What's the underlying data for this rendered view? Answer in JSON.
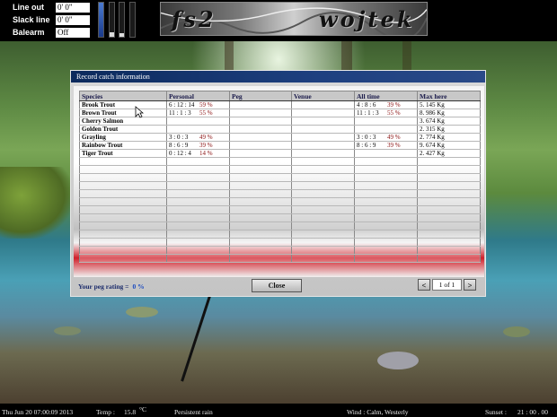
{
  "hud": {
    "line_out_label": "Line out",
    "line_out_value": "0' 0\"",
    "slack_line_label": "Slack line",
    "slack_line_value": "0' 0\"",
    "balearm_label": "Balearm",
    "balearm_value": "Off"
  },
  "logo": {
    "left_text": "fs2",
    "right_text": "wojtek"
  },
  "dialog": {
    "title": "Record catch information",
    "columns": [
      "Species",
      "Personal",
      "Peg",
      "Venue",
      "All time",
      "Max here"
    ],
    "rows": [
      {
        "species": "Brook Trout",
        "personal_time": "6 : 12 : 14",
        "personal_pct": "59 %",
        "peg": "",
        "venue": "",
        "alltime_time": "4 : 8 : 6",
        "alltime_pct": "39 %",
        "max": "5. 145 Kg"
      },
      {
        "species": "Brown Trout",
        "personal_time": "11 : 1 : 3",
        "personal_pct": "55 %",
        "peg": "",
        "venue": "",
        "alltime_time": "11 : 1 : 3",
        "alltime_pct": "55 %",
        "max": "8. 986 Kg"
      },
      {
        "species": "Cherry Salmon",
        "personal_time": "",
        "personal_pct": "",
        "peg": "",
        "venue": "",
        "alltime_time": "",
        "alltime_pct": "",
        "max": "3. 674 Kg"
      },
      {
        "species": "Golden Trout",
        "personal_time": "",
        "personal_pct": "",
        "peg": "",
        "venue": "",
        "alltime_time": "",
        "alltime_pct": "",
        "max": "2. 315 Kg"
      },
      {
        "species": "Grayling",
        "personal_time": "3 : 0 : 3",
        "personal_pct": "49 %",
        "peg": "",
        "venue": "",
        "alltime_time": "3 : 0 : 3",
        "alltime_pct": "49 %",
        "max": "2. 774 Kg"
      },
      {
        "species": "Rainbow Trout",
        "personal_time": "8 : 6 : 9",
        "personal_pct": "39 %",
        "peg": "",
        "venue": "",
        "alltime_time": "8 : 6 : 9",
        "alltime_pct": "39 %",
        "max": "9. 674 Kg"
      },
      {
        "species": "Tiger Trout",
        "personal_time": "0 : 12 : 4",
        "personal_pct": "14 %",
        "peg": "",
        "venue": "",
        "alltime_time": "",
        "alltime_pct": "",
        "max": "2. 427 Kg"
      }
    ],
    "rating_label": "Your peg rating =",
    "rating_value": "0 %",
    "close_label": "Close",
    "prev_label": "<",
    "page_current": "1",
    "page_of": "of 1",
    "next_label": ">"
  },
  "status": {
    "datetime": "Thu Jun 20 07:00:09 2013",
    "temp_label": "Temp :",
    "temp_value": "15.8",
    "temp_unit": "°C",
    "weather": "Persistent rain",
    "wind": "Wind : Calm, Westerly",
    "sunset_label": "Sunset :",
    "sunset_value": "21 : 00 . 00"
  },
  "colors": {
    "dialog_title_bg": "#1e4080",
    "pct_text": "#8a1010",
    "accent_red": "#d0202a"
  }
}
